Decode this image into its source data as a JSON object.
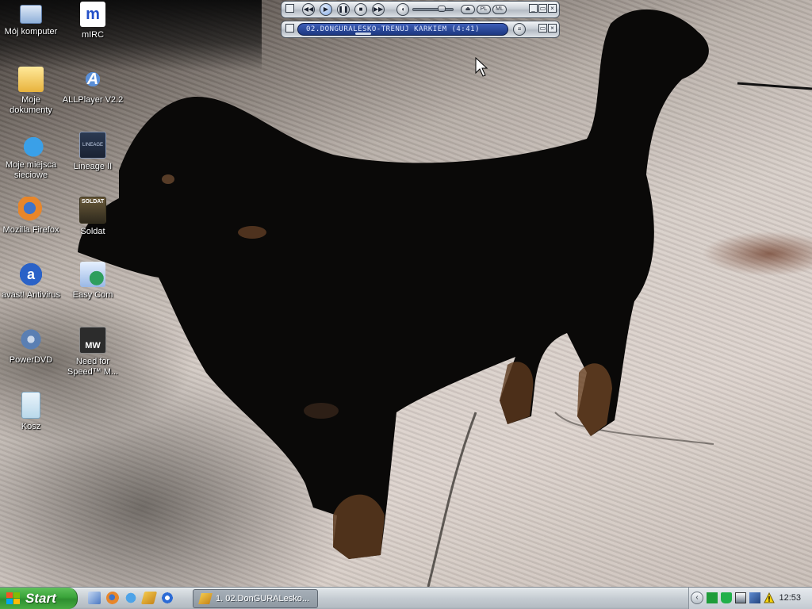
{
  "desktop": {
    "icons": [
      {
        "label": "Mój komputer",
        "icon": "my-computer-icon"
      },
      {
        "label": "mIRC",
        "icon": "mirc-icon"
      },
      {
        "label": "Moje dokumenty",
        "icon": "my-documents-icon"
      },
      {
        "label": "ALLPlayer V2.2",
        "icon": "allplayer-icon"
      },
      {
        "label": "Moje miejsca sieciowe",
        "icon": "network-places-icon"
      },
      {
        "label": "Lineage II",
        "icon": "lineage-icon"
      },
      {
        "label": "Mozilla Firefox",
        "icon": "firefox-icon"
      },
      {
        "label": "Soldat",
        "icon": "soldat-icon"
      },
      {
        "label": "avast! Antivirus",
        "icon": "avast-icon"
      },
      {
        "label": "Easy Com",
        "icon": "easy-com-icon"
      },
      {
        "label": "PowerDVD",
        "icon": "powerdvd-icon"
      },
      {
        "label": "Need for Speed™ M...",
        "icon": "need-for-speed-icon"
      },
      {
        "label": "Kosz",
        "icon": "recycle-bin-icon"
      }
    ],
    "icon_art": {
      "mirc": "m",
      "allplayer": "A",
      "lineage": "LINEAGE",
      "soldat": "SOLDAT",
      "avast": "a",
      "nfs": "MW"
    }
  },
  "winamp": {
    "main": {
      "buttons": [
        "previous",
        "play",
        "pause",
        "stop",
        "next"
      ],
      "volume_level": 0.78,
      "pills": {
        "eject": "⏏",
        "playlist": "PL",
        "library": "ML"
      }
    },
    "playlist": {
      "now_playing": "02.DONGURALESKO-TRENUJ KARKIEM (4:41)",
      "seek_position": 0.3
    },
    "window_controls": {
      "minimize": "_",
      "shade": "▭",
      "close": "×"
    }
  },
  "taskbar": {
    "start_label": "Start",
    "quick_launch": [
      "show-desktop-icon",
      "firefox-icon",
      "internet-explorer-icon",
      "winamp-icon",
      "media-player-icon"
    ],
    "task_item": "1. 02.DonGURALesko...",
    "tray_expand": "‹",
    "clock": "12:53"
  },
  "colors": {
    "start_green": "#3aa33a",
    "winamp_display_blue": "#1c3780",
    "taskbar_silver": "#c5ccd2"
  }
}
